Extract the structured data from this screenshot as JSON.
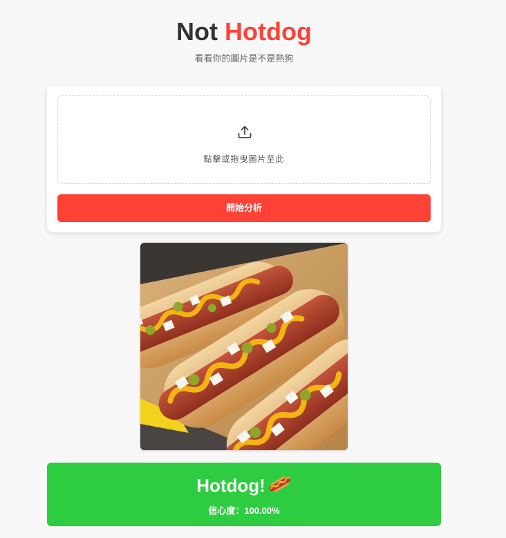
{
  "header": {
    "title_part1": "Not",
    "title_part2": "Hotdog",
    "subtitle": "看看你的圖片是不是熱狗"
  },
  "upload": {
    "icon": "upload-icon",
    "prompt": "點擊或拖曳圖片至此"
  },
  "actions": {
    "analyze_label": "開始分析"
  },
  "preview": {
    "image": "hotdog-photo"
  },
  "result": {
    "label": "Hotdog!",
    "emoji": "hotdog-emoji",
    "confidence_label": "信心度：",
    "confidence_value": "100.00%"
  },
  "colors": {
    "accent": "#ff4136",
    "success": "#2ecc40",
    "background": "#f8f8f8",
    "card": "#ffffff",
    "title_dark": "#333333"
  }
}
